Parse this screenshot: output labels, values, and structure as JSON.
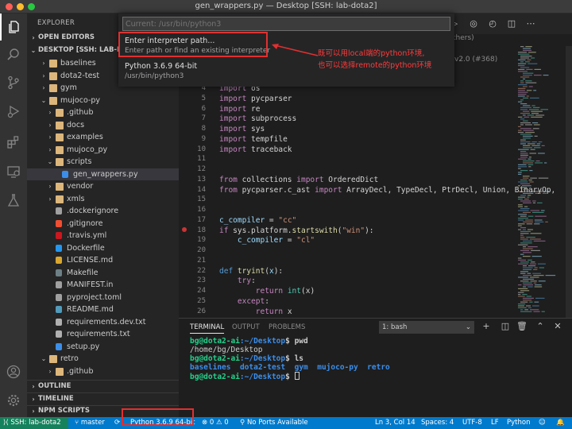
{
  "window": {
    "title": "gen_wrappers.py — Desktop [SSH: lab-dota2]"
  },
  "sidebar": {
    "title": "EXPLORER",
    "open_editors": "OPEN EDITORS",
    "workspace": "DESKTOP [SSH: LAB-D...",
    "tree": [
      {
        "label": "baselines",
        "kind": "folder",
        "depth": 1
      },
      {
        "label": "dota2-test",
        "kind": "folder",
        "depth": 1
      },
      {
        "label": "gym",
        "kind": "folder",
        "depth": 1
      },
      {
        "label": "mujoco-py",
        "kind": "folder-open",
        "depth": 1
      },
      {
        "label": ".github",
        "kind": "folder",
        "depth": 2
      },
      {
        "label": "docs",
        "kind": "folder",
        "depth": 2
      },
      {
        "label": "examples",
        "kind": "folder",
        "depth": 2
      },
      {
        "label": "mujoco_py",
        "kind": "folder",
        "depth": 2
      },
      {
        "label": "scripts",
        "kind": "folder-open",
        "depth": 2
      },
      {
        "label": "gen_wrappers.py",
        "kind": "python",
        "depth": 3
      },
      {
        "label": "vendor",
        "kind": "folder",
        "depth": 2
      },
      {
        "label": "xmls",
        "kind": "folder",
        "depth": 2
      },
      {
        "label": ".dockerignore",
        "kind": "file",
        "depth": 2
      },
      {
        "label": ".gitignore",
        "kind": "git",
        "depth": 2
      },
      {
        "label": ".travis.yml",
        "kind": "yml",
        "depth": 2
      },
      {
        "label": "Dockerfile",
        "kind": "docker",
        "depth": 2
      },
      {
        "label": "LICENSE.md",
        "kind": "license",
        "depth": 2
      },
      {
        "label": "Makefile",
        "kind": "make",
        "depth": 2
      },
      {
        "label": "MANIFEST.in",
        "kind": "file",
        "depth": 2
      },
      {
        "label": "pyproject.toml",
        "kind": "file",
        "depth": 2
      },
      {
        "label": "README.md",
        "kind": "md",
        "depth": 2
      },
      {
        "label": "requirements.dev.txt",
        "kind": "txt",
        "depth": 2
      },
      {
        "label": "requirements.txt",
        "kind": "txt",
        "depth": 2
      },
      {
        "label": "setup.py",
        "kind": "python",
        "depth": 2
      },
      {
        "label": "retro",
        "kind": "folder-open",
        "depth": 1
      },
      {
        "label": ".github",
        "kind": "folder",
        "depth": 2
      }
    ],
    "outline": "OUTLINE",
    "timeline": "TIMELINE",
    "npm_scripts": "NPM SCRIPTS"
  },
  "quick_pick": {
    "placeholder": "Current: /usr/bin/python3",
    "items": [
      {
        "label": "Enter interpreter path...",
        "detail": "Enter path or find an existing interpreter"
      },
      {
        "label": "Python 3.6.9 64-bit",
        "detail": "/usr/bin/python3"
      }
    ],
    "partial_right_text": "thers)"
  },
  "annotation": {
    "line1": "既可以用local端的python环境,",
    "line2": "也可以选择remote的python环境"
  },
  "editor": {
    "breadcrumb_right": "v2.0 (#368)",
    "lines": [
      4,
      5,
      6,
      7,
      8,
      9,
      10,
      11,
      12,
      13,
      14,
      15,
      16,
      17,
      18,
      19,
      20,
      21,
      22,
      23,
      24,
      25,
      26
    ],
    "code": {
      "l4a": "import",
      "l4b": " os",
      "l5a": "import",
      "l5b": " pycparser",
      "l6a": "import",
      "l6b": " re",
      "l7a": "import",
      "l7b": " subprocess",
      "l8a": "import",
      "l8b": " sys",
      "l9a": "import",
      "l9b": " tempfile",
      "l10a": "import",
      "l10b": " traceback",
      "l13a": "from",
      "l13b": " collections ",
      "l13c": "import",
      "l13d": " OrderedDict",
      "l14a": "from",
      "l14b": " pycparser.c_ast ",
      "l14c": "import",
      "l14d": " ArrayDecl, TypeDecl, PtrDecl, Union, BinaryOp,",
      "l17a": "c_compiler",
      "l17b": " = ",
      "l17c": "\"cc\"",
      "l18a": "if",
      "l18b": " sys.platform.",
      "l18c": "startswith",
      "l18d": "(",
      "l18e": "\"win\"",
      "l18f": "):",
      "l19a": "    c_compiler",
      "l19b": " = ",
      "l19c": "\"cl\"",
      "l22a": "def",
      "l22b": " ",
      "l22c": "tryint",
      "l22d": "(",
      "l22e": "x",
      "l22f": "):",
      "l23a": "    ",
      "l23b": "try",
      "l23c": ":",
      "l24a": "        ",
      "l24b": "return",
      "l24c": " ",
      "l24d": "int",
      "l24e": "(x)",
      "l25a": "    ",
      "l25b": "except",
      "l25c": ":",
      "l26a": "        ",
      "l26b": "return",
      "l26c": " x"
    }
  },
  "panel": {
    "tabs": [
      "TERMINAL",
      "OUTPUT",
      "PROBLEMS"
    ],
    "terminal_select": "1: bash",
    "terminal": {
      "prompt": "bg@dota2-ai",
      "path": ":~/Desktop",
      "dollar": "$ ",
      "cmd1": "pwd",
      "out1": "/home/bg/Desktop",
      "cmd2": "ls",
      "ls": [
        "baselines",
        "dota2-test",
        "gym",
        "mujoco-py",
        "retro"
      ]
    }
  },
  "statusbar": {
    "remote": "SSH: lab-dota2",
    "branch": "master",
    "interpreter": "Python 3.6.9 64-bit",
    "errors": "0",
    "warnings": "0",
    "ports": "No Ports Available",
    "position": "Ln 3, Col 14",
    "spaces": "Spaces: 4",
    "encoding": "UTF-8",
    "eol": "LF",
    "language": "Python"
  },
  "colors": {
    "accent": "#007acc",
    "remote": "#16825d",
    "highlight": "#e03030",
    "folder": "#dcb67a"
  }
}
